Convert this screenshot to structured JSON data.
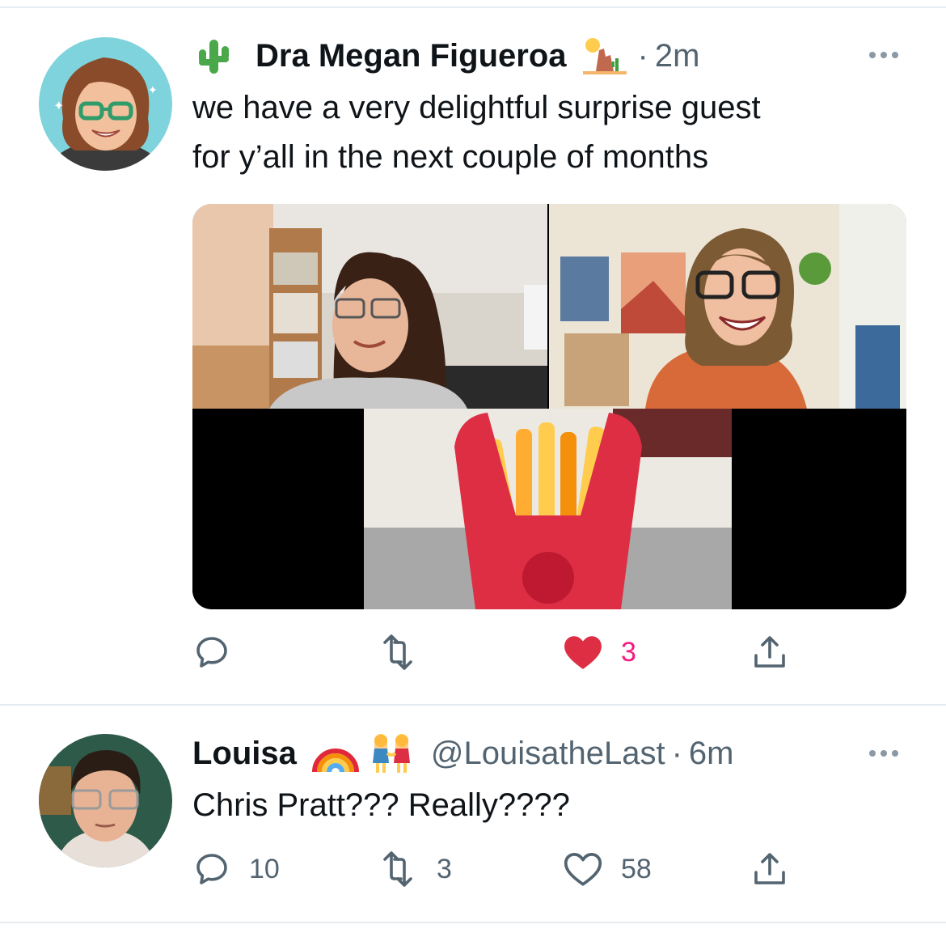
{
  "tweets": [
    {
      "display_name": "Dra Megan Figueroa",
      "name_prefix_emoji": "cactus",
      "name_suffix_emoji": "desert",
      "handle": "",
      "time": "2m",
      "text_lines": [
        "we have a very delightful surprise guest",
        "for y’all in the next couple of months"
      ],
      "has_media": true,
      "media_description_icons": [
        "video-call-grid",
        "french-fries-emoji"
      ],
      "actions": {
        "reply": "",
        "retweet": "",
        "like": "3",
        "like_active": true
      }
    },
    {
      "display_name": "Louisa",
      "name_suffix_emoji": [
        "rainbow",
        "two-women-holding-hands"
      ],
      "handle": "@LouisatheLast",
      "time": "6m",
      "text_lines": [
        "Chris Pratt??? Really????"
      ],
      "has_media": false,
      "actions": {
        "reply": "10",
        "retweet": "3",
        "like": "58",
        "like_active": false
      }
    }
  ],
  "separator_dot": "·",
  "colors": {
    "text": "#0f1419",
    "secondary": "#536471",
    "like_active": "#f91880",
    "divider": "#e6ecf0"
  }
}
